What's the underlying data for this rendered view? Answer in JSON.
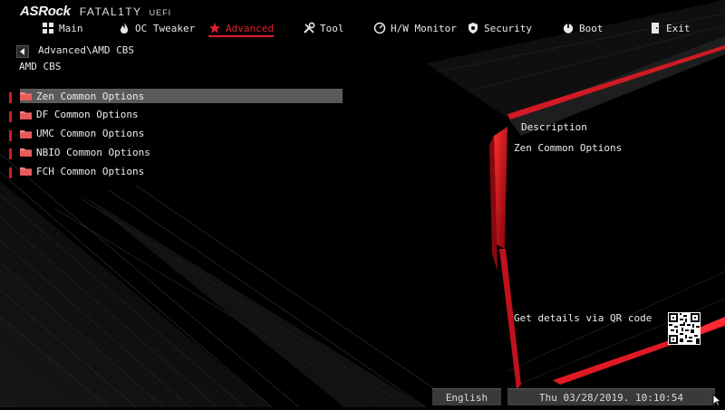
{
  "brand": {
    "maker": "ASRock",
    "line": "FATAL1TY",
    "suffix": "UEFI"
  },
  "nav": [
    {
      "label": "Main",
      "icon": "grid-icon"
    },
    {
      "label": "OC Tweaker",
      "icon": "flame-icon"
    },
    {
      "label": "Advanced",
      "icon": "star-icon",
      "active": true
    },
    {
      "label": "Tool",
      "icon": "tools-icon"
    },
    {
      "label": "H/W Monitor",
      "icon": "gauge-icon"
    },
    {
      "label": "Security",
      "icon": "shield-icon"
    },
    {
      "label": "Boot",
      "icon": "power-icon"
    },
    {
      "label": "Exit",
      "icon": "exit-door-icon"
    }
  ],
  "breadcrumb": "Advanced\\AMD CBS",
  "page_title": "AMD CBS",
  "options": [
    {
      "label": "Zen Common Options",
      "selected": true
    },
    {
      "label": "DF Common Options"
    },
    {
      "label": "UMC Common Options"
    },
    {
      "label": "NBIO Common Options"
    },
    {
      "label": "FCH Common Options"
    }
  ],
  "description": {
    "title": "Description",
    "body": "Zen Common Options"
  },
  "qr_text": "Get details via QR code",
  "footer": {
    "language": "English",
    "datetime": "Thu 03/28/2019. 10:10:54"
  },
  "colors": {
    "accent": "#e0202a",
    "selection": "#5a5a5a",
    "panel": "#3a3a3a",
    "background": "#000000"
  }
}
